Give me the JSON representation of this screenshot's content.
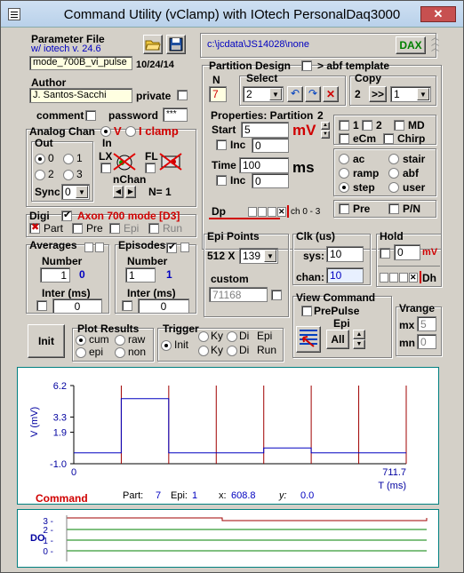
{
  "title": "Command Utility (vClamp) with IOtech PersonalDaq3000",
  "param": {
    "label": "Parameter File",
    "ver": "w/ iotech  v. 24.6",
    "file": "mode_700B_vi_pulse",
    "date": "10/24/14",
    "path": "c:\\jcdata\\JS14028\\none",
    "dax": "DAX"
  },
  "author": {
    "label": "Author",
    "name": "J. Santos-Sacchi",
    "private": "private",
    "comment": "comment",
    "password": "password",
    "pw": "***"
  },
  "analog": {
    "label": "Analog Chan",
    "v": "V",
    "i": "I clamp",
    "out": "Out",
    "opt0": "0",
    "opt1": "1",
    "opt2": "2",
    "opt3": "3",
    "in": "In",
    "lx": "LX",
    "fl": "FL",
    "sync": "Sync",
    "sync_val": "0",
    "nchan": "nChan",
    "n": "N=  1"
  },
  "digi": {
    "label": "Digi",
    "axon": "Axon 700 mode [D3]",
    "part": "Part",
    "pre": "Pre",
    "epi": "Epi",
    "run": "Run"
  },
  "averages": {
    "label": "Averages",
    "number": "Number",
    "num_val": "1",
    "num_disp": "0",
    "inter": "Inter (ms)",
    "inter_val": "0"
  },
  "episodes": {
    "label": "Episodes",
    "number": "Number",
    "num_val": "1",
    "num_disp": "1",
    "inter": "Inter (ms)",
    "inter_val": "0"
  },
  "init": "Init",
  "plotres": {
    "label": "Plot Results",
    "cum": "cum",
    "raw": "raw",
    "epi": "epi",
    "none": "non"
  },
  "trigger": {
    "label": "Trigger",
    "init": "Init",
    "ky1": "Ky",
    "di1": "Di",
    "epi": "Epi",
    "ky2": "Ky",
    "di2": "Di",
    "run": "Run"
  },
  "partition": {
    "label": "Partition Design",
    "abf": "> abf template",
    "n_label": "N",
    "n_val": "7",
    "select": "Select",
    "select_val": "2",
    "copy": "Copy",
    "copy_val": "2",
    "copy_to": ">>",
    "copy_sel": "1"
  },
  "props": {
    "label": "Properties: Partition",
    "pnum": "2",
    "start": "Start",
    "start_val": "5",
    "unit_mv": "mV",
    "inc": "Inc",
    "inc_val": "0",
    "time": "Time",
    "time_val": "100",
    "unit_ms": "ms",
    "inc2_val": "0",
    "c1": "1",
    "c2": "2",
    "md": "MD",
    "ecm": "eCm",
    "chirp": "Chirp",
    "ac": "ac",
    "stair": "stair",
    "ramp": "ramp",
    "abf": "abf",
    "step": "step",
    "user": "user",
    "pre": "Pre",
    "pn": "P/N",
    "dp": "Dp",
    "ch": "ch 0 - 3"
  },
  "epipts": {
    "label": "Epi Points",
    "base": "512 X",
    "mult": "139",
    "custom": "custom",
    "custom_val": "71168"
  },
  "clk": {
    "label": "Clk (us)",
    "sys": "sys:",
    "sys_val": "10",
    "chan": "chan:",
    "chan_val": "10"
  },
  "hold": {
    "label": "Hold",
    "val": "0",
    "unit": "mV",
    "dh": "Dh"
  },
  "viewcmd": {
    "label": "View Command",
    "prepulse": "PrePulse",
    "epi": "Epi",
    "all": "All"
  },
  "vrange": {
    "label": "Vrange",
    "mx": "mx",
    "mx_val": "5",
    "mn": "mn",
    "mn_val": "0"
  },
  "chart_data": {
    "type": "line",
    "ylabel": "V (mV)",
    "xlabel": "T (ms)",
    "yticks": [
      "6.2",
      "3.3",
      "1.9",
      "-1.0"
    ],
    "xticks": [
      "0",
      "711.7"
    ],
    "xlim": [
      0,
      711.7
    ],
    "x": [
      0,
      101.7,
      101.7,
      203.3,
      203.3,
      305,
      305,
      406.7,
      406.7,
      508.3,
      508.3,
      610,
      610,
      711.7
    ],
    "y": [
      0,
      0,
      5,
      5,
      0,
      0,
      0,
      0,
      0.45,
      0.45,
      0,
      0,
      0,
      0
    ]
  },
  "status": {
    "cmd": "Command",
    "part": "Part:",
    "part_val": "7",
    "epi": "Epi:",
    "epi_val": "1",
    "x": "x:",
    "x_val": "608.8",
    "y": "y:",
    "y_val": "0.0"
  },
  "dio": {
    "label": "DO",
    "ticks": [
      "3",
      "2",
      "1",
      "0"
    ]
  }
}
